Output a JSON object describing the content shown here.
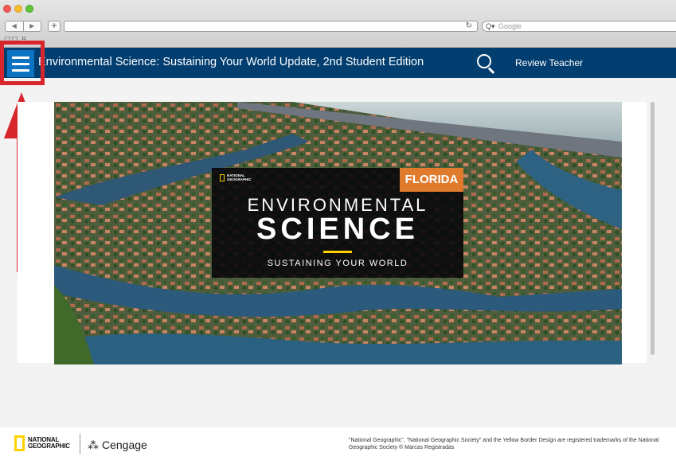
{
  "browser": {
    "back_glyph": "◀",
    "forward_glyph": "▶",
    "new_tab_glyph": "+",
    "reload_glyph": "↻",
    "search_prefix": "Q▾",
    "search_placeholder": "Google",
    "bookmarks_glyphs": "☐☐ ⠿"
  },
  "header": {
    "title": "Environmental Science: Sustaining Your World Update, 2nd Student Edition",
    "review_link": "Review Teacher",
    "icons": [
      "menu-icon",
      "search-icon"
    ]
  },
  "cover": {
    "logo_line1": "NATIONAL",
    "logo_line2": "GEOGRAPHIC",
    "edition_badge": "FLORIDA",
    "title_line1": "ENVIRONMENTAL",
    "title_line2": "SCIENCE",
    "subtitle": "SUSTAINING YOUR WORLD"
  },
  "footer": {
    "ng_line1": "NATIONAL",
    "ng_line2": "GEOGRAPHIC",
    "cengage_mark": "⁂",
    "cengage": "Cengage",
    "legal": "\"National Geographic\", \"National Geographic Society\" and the Yellow Border Design are registered trademarks of the National Geographic Society ® Marcas Registradas"
  },
  "colors": {
    "header_bg": "#023e70",
    "menu_button_bg": "#0f73c4",
    "annotation_red": "#d9262d",
    "florida_orange": "#e07a2c",
    "ng_yellow": "#ffd200"
  }
}
